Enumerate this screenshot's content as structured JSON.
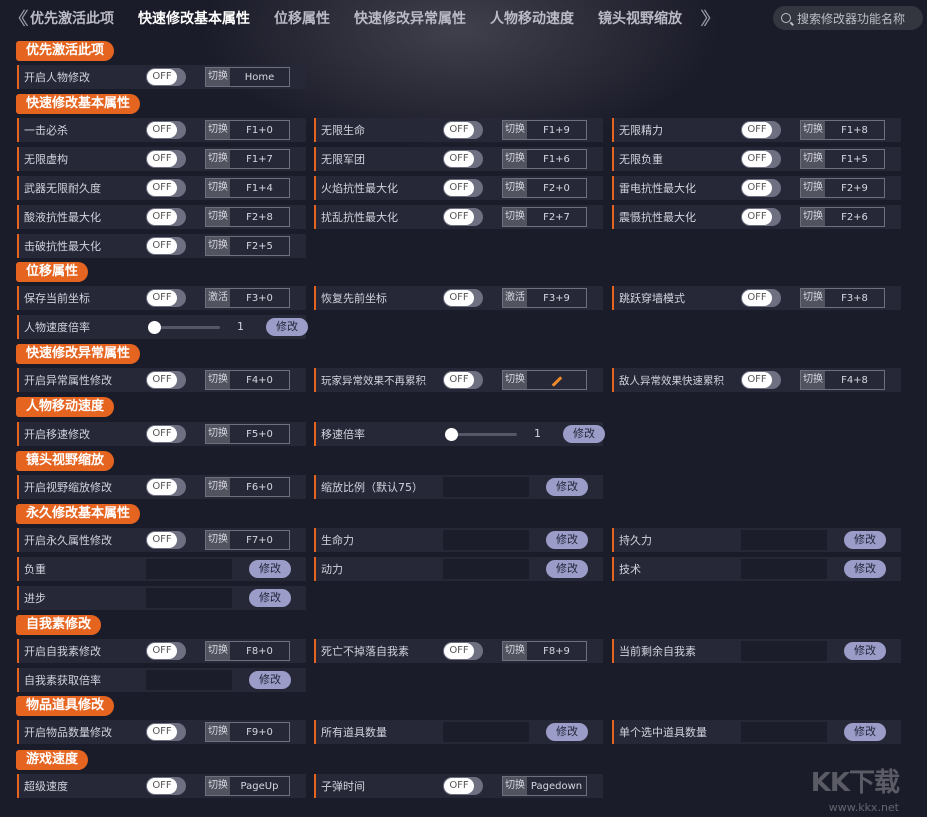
{
  "tabs": [
    "优先激活此项",
    "快速修改基本属性",
    "位移属性",
    "快速修改异常属性",
    "人物移动速度",
    "镜头视野缩放"
  ],
  "active_tab": 1,
  "search_placeholder": "搜索修改器功能名称",
  "sections": {
    "priority": "优先激活此项",
    "basic": "快速修改基本属性",
    "move": "位移属性",
    "abnormal": "快速修改异常属性",
    "speed": "人物移动速度",
    "camera": "镜头视野缩放",
    "permanent": "永久修改基本属性",
    "ego": "自我素修改",
    "items": "物品道具修改",
    "gamespeed": "游戏速度"
  },
  "off": "OFF",
  "switch": "切换",
  "activate": "激活",
  "modify": "修改",
  "rows": {
    "p1": {
      "label": "开启人物修改",
      "key": "Home"
    },
    "b1": {
      "label": "一击必杀",
      "key": "F1+0"
    },
    "b2": {
      "label": "无限生命",
      "key": "F1+9"
    },
    "b3": {
      "label": "无限精力",
      "key": "F1+8"
    },
    "b4": {
      "label": "无限虚构",
      "key": "F1+7"
    },
    "b5": {
      "label": "无限军团",
      "key": "F1+6"
    },
    "b6": {
      "label": "无限负重",
      "key": "F1+5"
    },
    "b7": {
      "label": "武器无限耐久度",
      "key": "F1+4"
    },
    "b8": {
      "label": "火焰抗性最大化",
      "key": "F2+0"
    },
    "b9": {
      "label": "雷电抗性最大化",
      "key": "F2+9"
    },
    "b10": {
      "label": "酸液抗性最大化",
      "key": "F2+8"
    },
    "b11": {
      "label": "扰乱抗性最大化",
      "key": "F2+7"
    },
    "b12": {
      "label": "震慑抗性最大化",
      "key": "F2+6"
    },
    "b13": {
      "label": "击破抗性最大化",
      "key": "F2+5"
    },
    "m1": {
      "label": "保存当前坐标",
      "key": "F3+0"
    },
    "m2": {
      "label": "恢复先前坐标",
      "key": "F3+9"
    },
    "m3": {
      "label": "跳跃穿墙模式",
      "key": "F3+8"
    },
    "m4": {
      "label": "人物速度倍率",
      "value": "1"
    },
    "a1": {
      "label": "开启异常属性修改",
      "key": "F4+0"
    },
    "a2": {
      "label": "玩家异常效果不再累积",
      "key": ""
    },
    "a3": {
      "label": "敌人异常效果快速累积",
      "key": "F4+8"
    },
    "s1": {
      "label": "开启移速修改",
      "key": "F5+0"
    },
    "s2": {
      "label": "移速倍率",
      "value": "1"
    },
    "c1": {
      "label": "开启视野缩放修改",
      "key": "F6+0"
    },
    "c2": {
      "label": "缩放比例（默认75）"
    },
    "pm1": {
      "label": "开启永久属性修改",
      "key": "F7+0"
    },
    "pm2": {
      "label": "生命力"
    },
    "pm3": {
      "label": "持久力"
    },
    "pm4": {
      "label": "负重"
    },
    "pm5": {
      "label": "动力"
    },
    "pm6": {
      "label": "技术"
    },
    "pm7": {
      "label": "进步"
    },
    "e1": {
      "label": "开启自我素修改",
      "key": "F8+0"
    },
    "e2": {
      "label": "死亡不掉落自我素",
      "key": "F8+9"
    },
    "e3": {
      "label": "当前剩余自我素"
    },
    "e4": {
      "label": "自我素获取倍率"
    },
    "i1": {
      "label": "开启物品数量修改",
      "key": "F9+0"
    },
    "i2": {
      "label": "所有道具数量"
    },
    "i3": {
      "label": "单个选中道具数量"
    },
    "g1": {
      "label": "超级速度",
      "key": "PageUp"
    },
    "g2": {
      "label": "子弹时间",
      "key": "Pagedown"
    }
  },
  "watermark": "KK下载",
  "watermark_url": "www.kkx.net"
}
